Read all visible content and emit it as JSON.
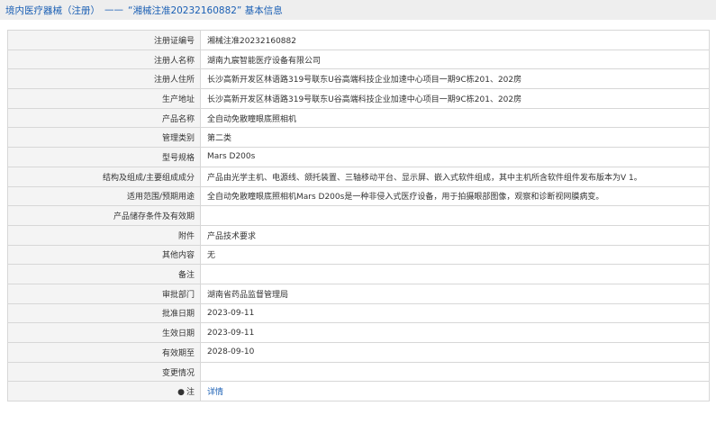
{
  "header": {
    "category": "境内医疗器械（注册）",
    "separator": "——",
    "title": "“湘械注准20232160882”  基本信息"
  },
  "rows": [
    {
      "label": "注册证编号",
      "value": "湘械注准20232160882"
    },
    {
      "label": "注册人名称",
      "value": "湖南九宸智能医疗设备有限公司"
    },
    {
      "label": "注册人住所",
      "value": "长沙高新开发区林语路319号联东U谷高端科技企业加速中心项目一期9C栋201、202房"
    },
    {
      "label": "生产地址",
      "value": "长沙高新开发区林语路319号联东U谷高端科技企业加速中心项目一期9C栋201、202房"
    },
    {
      "label": "产品名称",
      "value": "全自动免散瞳眼底照相机"
    },
    {
      "label": "管理类别",
      "value": "第二类"
    },
    {
      "label": "型号规格",
      "value": "Mars D200s"
    },
    {
      "label": "结构及组成/主要组成成分",
      "value": "产品由光学主机、电源线、颌托装置、三轴移动平台、显示屏、嵌入式软件组成，其中主机所含软件组件发布版本为V 1。"
    },
    {
      "label": "适用范围/预期用途",
      "value": "全自动免散瞳眼底照相机Mars D200s是一种非侵入式医疗设备，用于拍摄眼部图像，观察和诊断视网膜病变。"
    },
    {
      "label": "产品储存条件及有效期",
      "value": ""
    },
    {
      "label": "附件",
      "value": "产品技术要求"
    },
    {
      "label": "其他内容",
      "value": "无"
    },
    {
      "label": "备注",
      "value": ""
    },
    {
      "label": "审批部门",
      "value": "湖南省药品监督管理局"
    },
    {
      "label": "批准日期",
      "value": "2023-09-11"
    },
    {
      "label": "生效日期",
      "value": "2023-09-11"
    },
    {
      "label": "有效期至",
      "value": "2028-09-10"
    },
    {
      "label": "变更情况",
      "value": ""
    }
  ],
  "note_row": {
    "icon": "info-icon",
    "label": "注",
    "link_text": "详情"
  }
}
